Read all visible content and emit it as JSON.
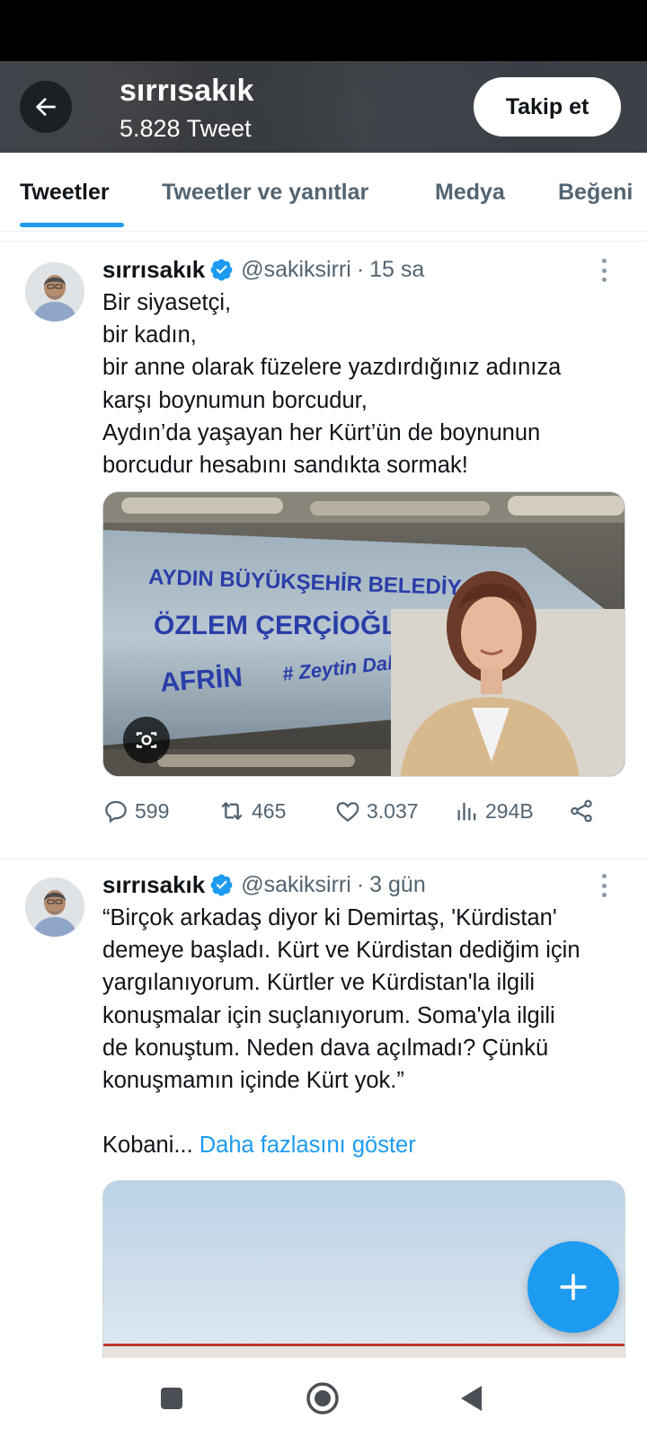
{
  "header": {
    "title": "sırrısakık",
    "subtitle": "5.828 Tweet",
    "follow_label": "Takip et"
  },
  "tabs": [
    {
      "label": "Tweetler",
      "active": true
    },
    {
      "label": "Tweetler ve yanıtlar",
      "active": false
    },
    {
      "label": "Medya",
      "active": false
    },
    {
      "label": "Beğeni",
      "active": false
    }
  ],
  "tweets": [
    {
      "name": "sırrısakık",
      "handle": "@sakiksirri",
      "separator": "·",
      "time": "15 sa",
      "lines": [
        "Bir siyasetçi,",
        "bir kadın,",
        "bir anne olarak füzelere yazdırdığınız adınıza",
        "karşı boynumun borcudur,",
        "Aydın’da yaşayan her Kürt’ün de boynunun",
        "borcudur hesabını sandıkta sormak!"
      ],
      "media_text": [
        "AYDIN BÜYÜKŞEHİR BELEDİY",
        "ÖZLEM ÇERÇİOĞLU",
        "AFRİN",
        "# Zeytin Dalı"
      ],
      "stats": {
        "replies": "599",
        "retweets": "465",
        "likes": "3.037",
        "views": "294B"
      }
    },
    {
      "name": "sırrısakık",
      "handle": "@sakiksirri",
      "separator": "·",
      "time": "3 gün",
      "lines": [
        "“Birçok arkadaş diyor ki Demirtaş, 'Kürdistan'",
        "demeye başladı. Kürt ve Kürdistan dediğim için",
        "yargılanıyorum. Kürtler ve Kürdistan'la ilgili",
        "konuşmalar için suçlanıyorum. Soma'yla ilgili",
        "de konuştum. Neden dava açılmadı? Çünkü",
        "konuşmamın içinde Kürt yok.”"
      ],
      "truncated_text": "Kobani...",
      "show_more_label": "Daha fazlasını göster"
    }
  ],
  "colors": {
    "accent": "#1d9bf0",
    "text_primary": "#0f1419",
    "text_secondary": "#536471"
  }
}
